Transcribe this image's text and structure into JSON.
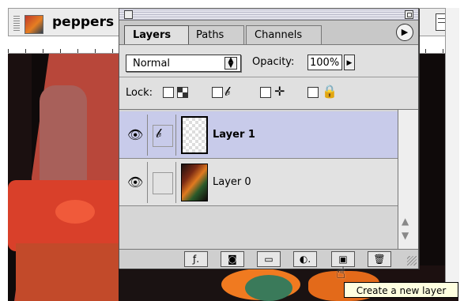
{
  "document": {
    "title": "peppers p"
  },
  "palette": {
    "tabs": [
      {
        "label": "Layers"
      },
      {
        "label": "Paths"
      },
      {
        "label": "Channels"
      }
    ],
    "blend_mode": "Normal",
    "opacity_label": "Opacity:",
    "opacity_value": "100%",
    "lock_label": "Lock:",
    "layers": [
      {
        "name": "Layer 1",
        "selected": true
      },
      {
        "name": "Layer 0",
        "selected": false
      }
    ]
  },
  "tooltip": {
    "text": "Create a new layer"
  },
  "colors": {
    "selected_row": "#c8cbea",
    "tooltip_bg": "#ffffe0"
  }
}
